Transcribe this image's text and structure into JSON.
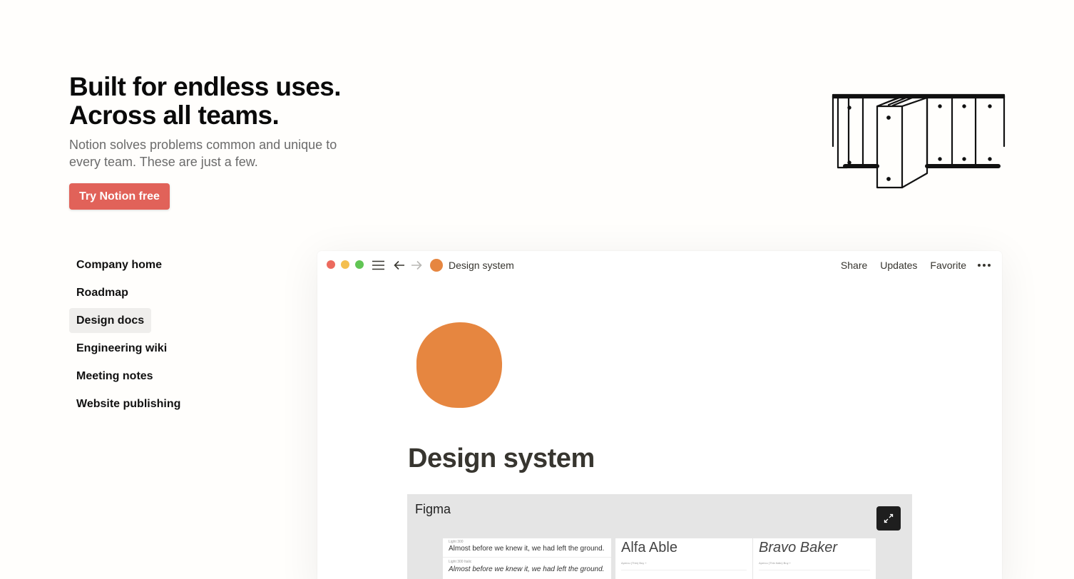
{
  "hero": {
    "title_line1": "Built for endless uses.",
    "title_line2": "Across all teams.",
    "subtitle": "Notion solves problems common and unique to every team. These are just a few.",
    "cta_label": "Try Notion free"
  },
  "side_nav": {
    "items": [
      {
        "label": "Company home"
      },
      {
        "label": "Roadmap"
      },
      {
        "label": "Design docs"
      },
      {
        "label": "Engineering wiki"
      },
      {
        "label": "Meeting notes"
      },
      {
        "label": "Website publishing"
      }
    ],
    "active_index": 2
  },
  "app": {
    "breadcrumb": "Design system",
    "actions": {
      "share": "Share",
      "updates": "Updates",
      "favorite": "Favorite"
    },
    "page_title": "Design system",
    "page_icon_color": "#e68640",
    "embed": {
      "label": "Figma",
      "card1": {
        "caption_a": "Light 300",
        "text_a": "Almost before we knew it, we had left the ground.",
        "caption_b": "Light 300 Italic",
        "text_b": "Almost before we knew it, we had left the ground."
      },
      "card2": {
        "heading": "Alfa Able",
        "caption": "Apercu (Thin)   Buy +"
      },
      "card3": {
        "heading": "Bravo Baker",
        "caption": "Apercu (Thin Italic)   Buy +"
      }
    }
  },
  "colors": {
    "background": "#fffefc",
    "cta": "#e16259",
    "active_nav": "#efeeec",
    "traffic_red": "#ec6a5e",
    "traffic_yellow": "#f4bf4f",
    "traffic_green": "#61c554"
  }
}
